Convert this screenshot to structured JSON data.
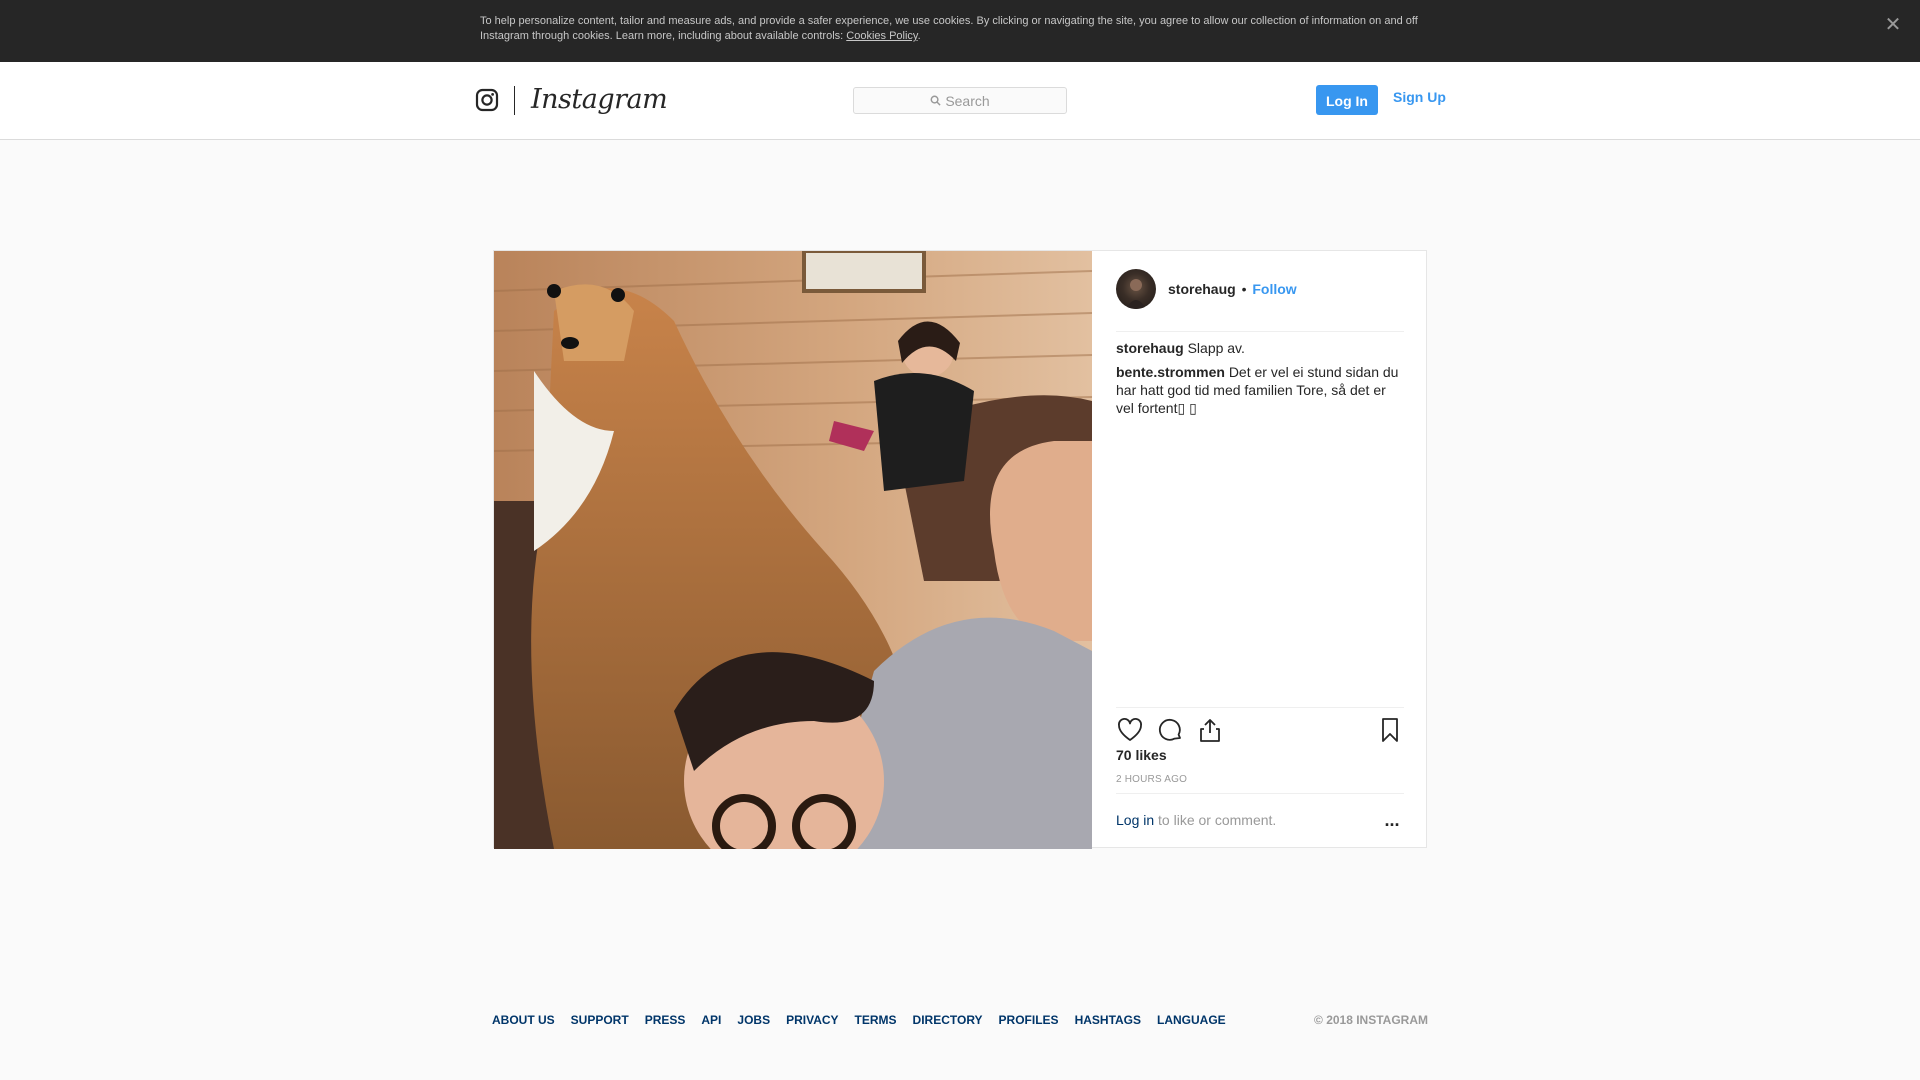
{
  "cookie_banner": {
    "text": "To help personalize content, tailor and measure ads, and provide a safer experience, we use cookies. By clicking or navigating the site, you agree to allow our collection of information on and off Instagram through cookies. Learn more, including about available controls: ",
    "link_label": "Cookies Policy",
    "close_icon": "close-icon"
  },
  "header": {
    "logo_icon": "camera-icon",
    "wordmark": "Instagram",
    "search_placeholder": "Search",
    "login_label": "Log In",
    "signup_label": "Sign Up"
  },
  "post": {
    "author": "storehaug",
    "separator": "•",
    "follow_label": "Follow",
    "comments": [
      {
        "user": "storehaug",
        "text": "Slapp av."
      },
      {
        "user": "bente.strommen",
        "text": "Det er vel ei stund sidan du har hatt god tid med familien Tore, så det er vel fortent▯ ▯"
      }
    ],
    "likes": "70 likes",
    "time_ago": "2 HOURS AGO",
    "login_link": "Log in",
    "login_suffix": " to like or comment.",
    "more_label": "..."
  },
  "footer": {
    "links": [
      "ABOUT US",
      "SUPPORT",
      "PRESS",
      "API",
      "JOBS",
      "PRIVACY",
      "TERMS",
      "DIRECTORY",
      "PROFILES",
      "HASHTAGS",
      "LANGUAGE"
    ],
    "copyright": "© 2018 INSTAGRAM"
  },
  "colors": {
    "accent": "#3897f0",
    "link_dark": "#003569",
    "banner_bg": "#262626"
  }
}
